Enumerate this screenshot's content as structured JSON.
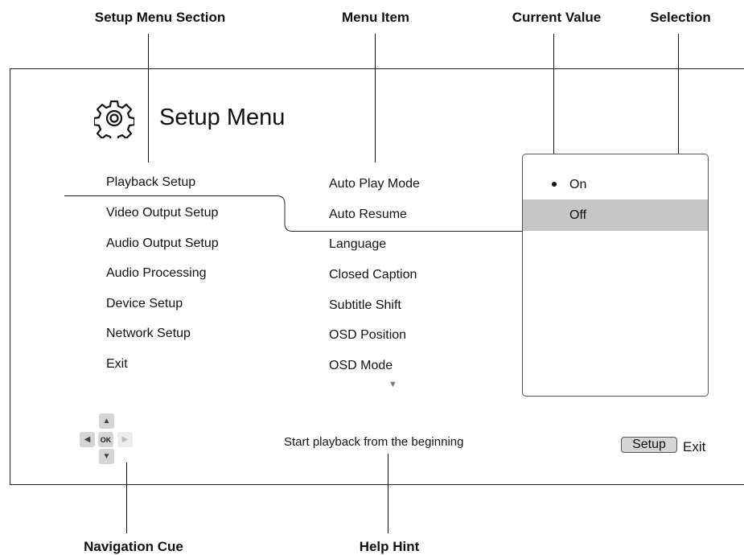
{
  "callouts": {
    "setup_menu_section": "Setup Menu Section",
    "menu_item": "Menu Item",
    "current_value": "Current Value",
    "selection": "Selection",
    "navigation_cue": "Navigation Cue",
    "help_hint": "Help Hint"
  },
  "screen": {
    "title": "Setup Menu",
    "sections": [
      "Playback Setup",
      "Video Output Setup",
      "Audio Output Setup",
      "Audio Processing",
      "Device Setup",
      "Network Setup",
      "Exit"
    ],
    "menu_items": [
      "Auto Play Mode",
      "Auto Resume",
      "Language",
      "Closed Caption",
      "Subtitle Shift",
      "OSD Position",
      "OSD Mode"
    ],
    "options": [
      "On",
      "Off"
    ],
    "current_value": "On",
    "selected_option": "Off",
    "help_text": "Start playback from the beginning",
    "nav": {
      "ok": "OK"
    },
    "setup_key": "Setup",
    "exit_label": "Exit"
  },
  "colors": {
    "highlight": "#c6c6c6",
    "line": "#111111"
  },
  "icons": [
    "gear-icon",
    "scroll-down-icon",
    "arrow-up-icon",
    "arrow-down-icon",
    "arrow-left-icon",
    "arrow-right-icon"
  ]
}
